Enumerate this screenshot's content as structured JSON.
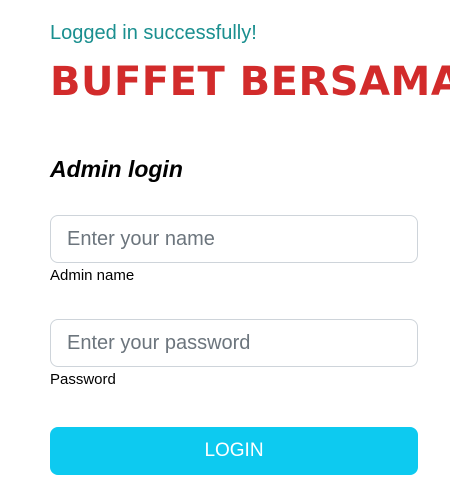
{
  "flash": {
    "message": "Logged in successfully!",
    "color": "#1a8f8f"
  },
  "brand": {
    "title": "BUFFET BERSAMA",
    "color": "#d22b2b"
  },
  "form": {
    "title": "Admin login",
    "name_field": {
      "placeholder": "Enter your name",
      "label": "Admin name"
    },
    "password_field": {
      "placeholder": "Enter your password",
      "label": "Password"
    },
    "submit_label": "LOGIN",
    "submit_color": "#0dcaf0"
  }
}
